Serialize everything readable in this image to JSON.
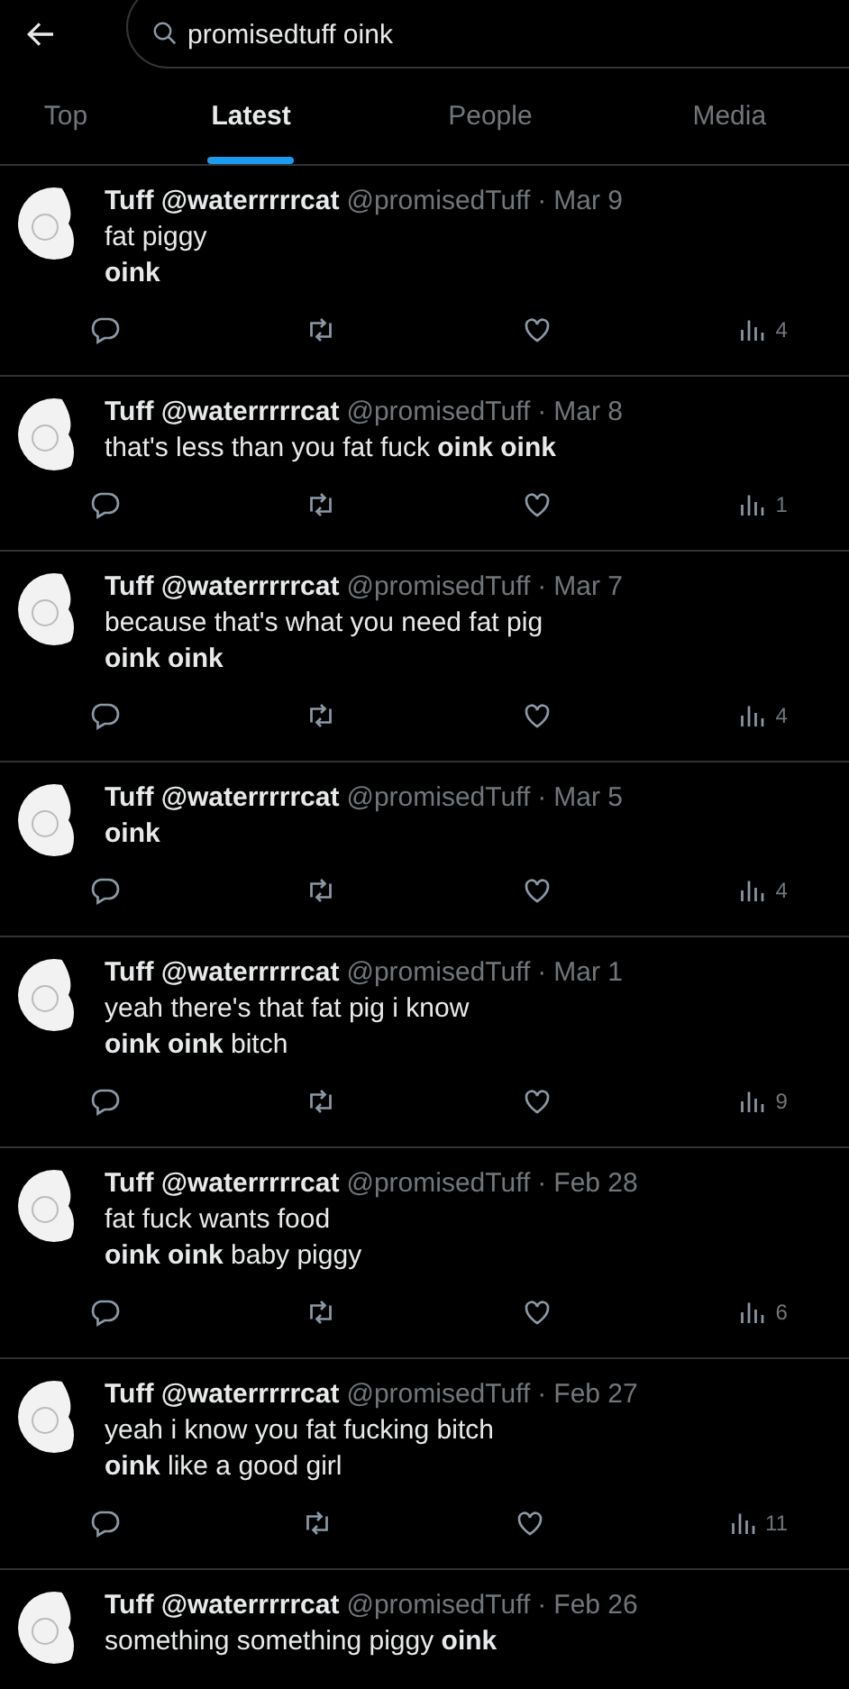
{
  "search": {
    "value": "promisedtuff oink"
  },
  "tabs": [
    {
      "label": "Top",
      "selected": false
    },
    {
      "label": "Latest",
      "selected": true
    },
    {
      "label": "People",
      "selected": false
    },
    {
      "label": "Media",
      "selected": false
    }
  ],
  "tweets": [
    {
      "name": "Tuff @waterrrrrcat",
      "handle": "@promisedTuff",
      "sep": "·",
      "date": "Mar 9",
      "lines": [
        "fat piggy",
        "**oink**"
      ],
      "views": "4"
    },
    {
      "name": "Tuff @waterrrrrcat",
      "handle": "@promisedTuff",
      "sep": "·",
      "date": "Mar 8",
      "lines": [
        "that's less than you fat fuck **oink oink**"
      ],
      "views": "1"
    },
    {
      "name": "Tuff @waterrrrrcat",
      "handle": "@promisedTuff",
      "sep": "·",
      "date": "Mar 7",
      "lines": [
        "because that's what you need fat pig",
        "**oink oink**"
      ],
      "views": "4"
    },
    {
      "name": "Tuff @waterrrrrcat",
      "handle": "@promisedTuff",
      "sep": "·",
      "date": "Mar 5",
      "lines": [
        "**oink**"
      ],
      "views": "4"
    },
    {
      "name": "Tuff @waterrrrrcat",
      "handle": "@promisedTuff",
      "sep": "·",
      "date": "Mar 1",
      "lines": [
        "yeah there's that fat pig i know",
        "**oink oink** bitch"
      ],
      "views": "9"
    },
    {
      "name": "Tuff @waterrrrrcat",
      "handle": "@promisedTuff",
      "sep": "·",
      "date": "Feb 28",
      "lines": [
        "fat fuck wants food",
        "**oink oink** baby piggy"
      ],
      "views": "6"
    },
    {
      "name": "Tuff @waterrrrrcat",
      "handle": "@promisedTuff",
      "sep": "·",
      "date": "Feb 27",
      "lines": [
        "yeah i know you fat fucking bitch",
        "**oink** like a good girl"
      ],
      "views": "11"
    },
    {
      "name": "Tuff @waterrrrrcat",
      "handle": "@promisedTuff",
      "sep": "·",
      "date": "Feb 26",
      "lines": [
        "something something piggy **oink**"
      ]
    }
  ]
}
